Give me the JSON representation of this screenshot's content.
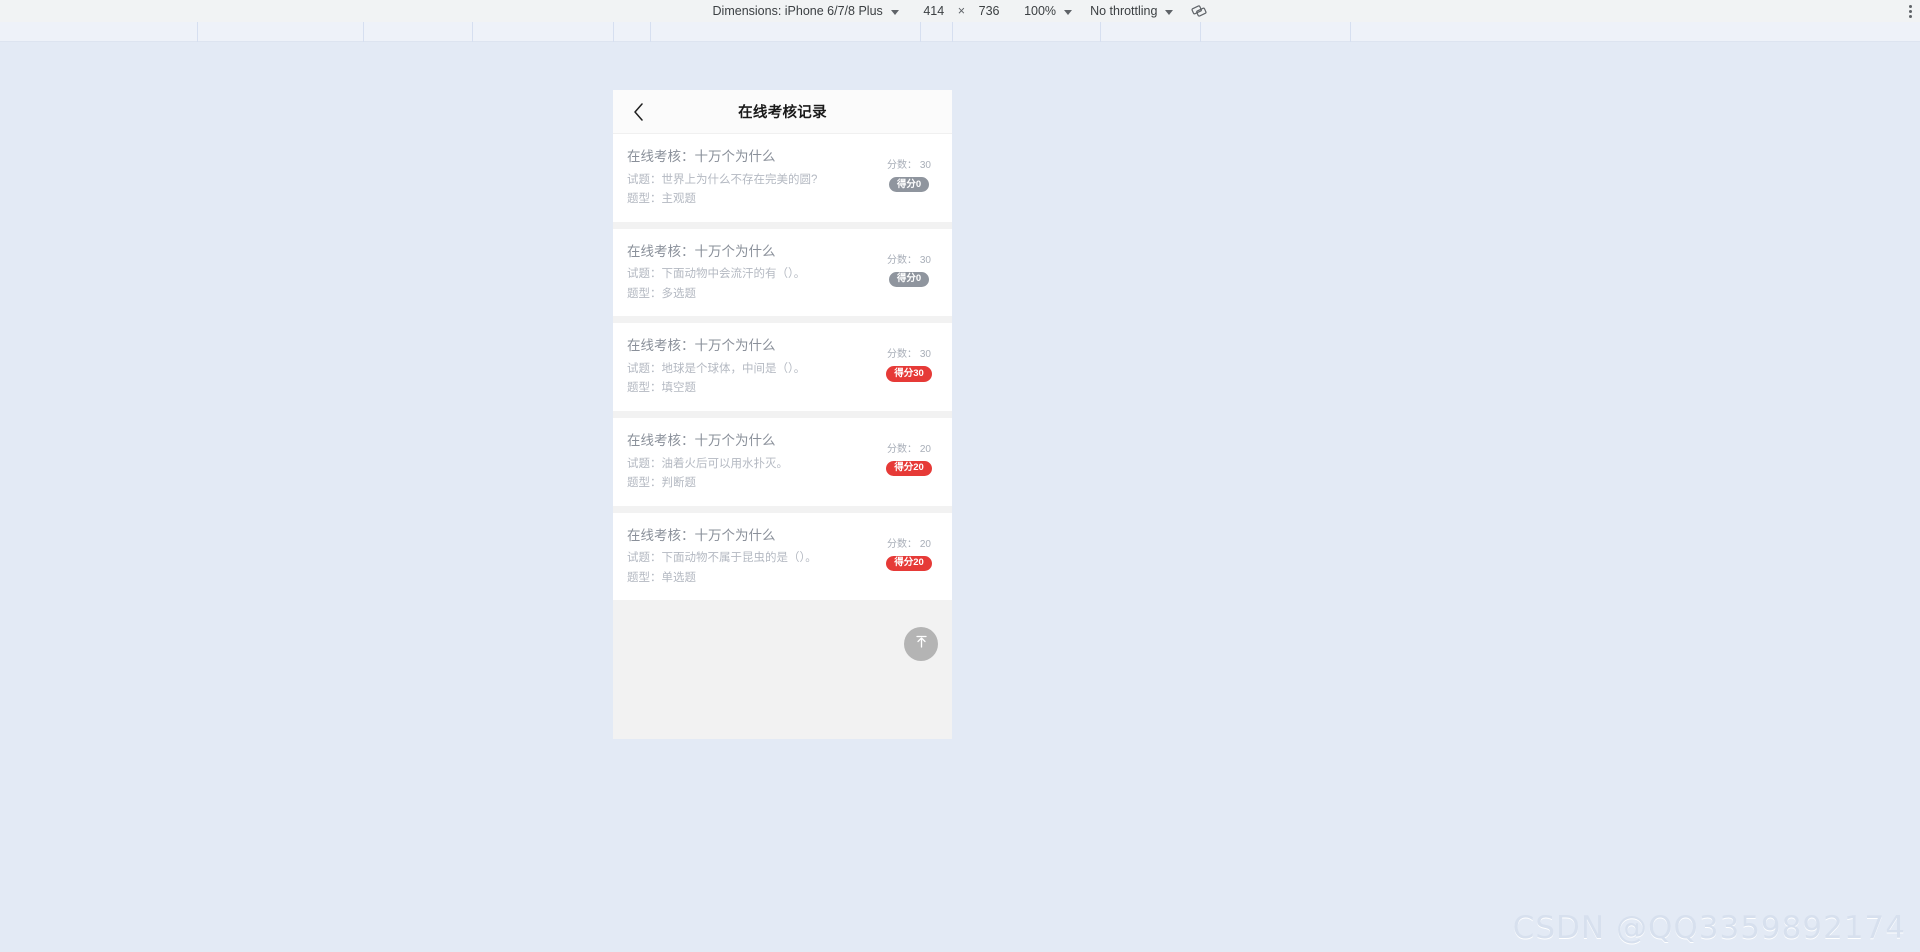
{
  "devtools_toolbar": {
    "dimensions_label": "Dimensions: iPhone 6/7/8 Plus",
    "width_value": "414",
    "times_symbol": "×",
    "height_value": "736",
    "zoom_value": "100%",
    "throttling_value": "No throttling",
    "rotate_icon": "rotate-device-icon",
    "menu_icon": "kebab-menu-icon"
  },
  "app": {
    "header": {
      "back_icon": "chevron-left-icon",
      "title": "在线考核记录"
    },
    "records": [
      {
        "title": "在线考核：十万个为什么",
        "question": "试题：世界上为什么不存在完美的圆?",
        "type": "题型：主观题",
        "score_label": "分数：",
        "score_value": "30",
        "badge": "得分0",
        "badge_state": "zero"
      },
      {
        "title": "在线考核：十万个为什么",
        "question": "试题：下面动物中会流汗的有（）。",
        "type": "题型：多选题",
        "score_label": "分数：",
        "score_value": "30",
        "badge": "得分0",
        "badge_state": "zero"
      },
      {
        "title": "在线考核：十万个为什么",
        "question": "试题：地球是个球体，中间是（）。",
        "type": "题型：填空题",
        "score_label": "分数：",
        "score_value": "30",
        "badge": "得分30",
        "badge_state": "scored"
      },
      {
        "title": "在线考核：十万个为什么",
        "question": "试题：油着火后可以用水扑灭。",
        "type": "题型：判断题",
        "score_label": "分数：",
        "score_value": "20",
        "badge": "得分20",
        "badge_state": "scored"
      },
      {
        "title": "在线考核：十万个为什么",
        "question": "试题：下面动物不属于昆虫的是（）。",
        "type": "题型：单选题",
        "score_label": "分数：",
        "score_value": "20",
        "badge": "得分20",
        "badge_state": "scored"
      }
    ],
    "back_to_top_icon": "scroll-to-top-icon"
  },
  "watermark": "CSDN @QQ3359892174",
  "colors": {
    "page_background": "#e3eaf5",
    "card_background": "#ffffff",
    "list_background": "#f2f2f2",
    "badge_zero": "#8f959e",
    "badge_scored": "#e63a37",
    "toolbar_background": "#f1f3f4"
  }
}
